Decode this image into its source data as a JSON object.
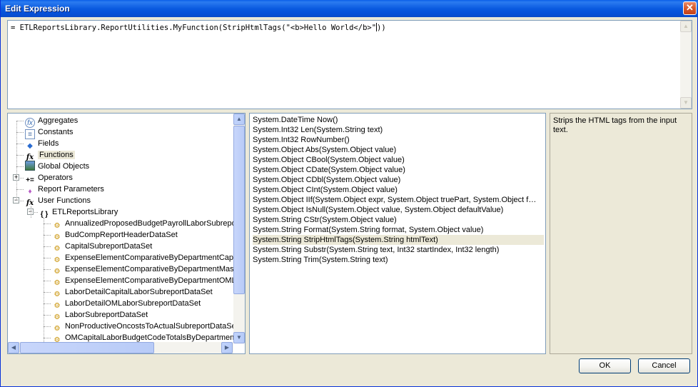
{
  "window": {
    "title": "Edit Expression",
    "close_glyph": "✕"
  },
  "expression": {
    "text_before_caret": "= ETLReportsLibrary.ReportUtilities.MyFunction(StripHtmlTags(\"<b>Hello World</b>\"",
    "text_after_caret": "))"
  },
  "tree": {
    "items": [
      {
        "label": "Aggregates",
        "icon": "aggregates-icon",
        "glyph": "fx"
      },
      {
        "label": "Constants",
        "icon": "constants-icon",
        "glyph": "≡"
      },
      {
        "label": "Fields",
        "icon": "fields-icon",
        "glyph": "◆"
      },
      {
        "label": "Functions",
        "icon": "functions-icon",
        "glyph": "fx"
      },
      {
        "label": "Global Objects",
        "icon": "global-objects-icon",
        "glyph": ""
      },
      {
        "label": "Operators",
        "icon": "operators-icon",
        "glyph": "+="
      },
      {
        "label": "Report Parameters",
        "icon": "report-parameters-icon",
        "glyph": "♦"
      },
      {
        "label": "User Functions",
        "icon": "user-functions-icon",
        "glyph": "fx"
      },
      {
        "label": "ETLReportsLibrary",
        "icon": "namespace-braces-icon",
        "glyph": "{ }"
      },
      {
        "label": "AnnualizedProposedBudgetPayrollLaborSubreport",
        "icon": "dataset-icon",
        "glyph": "⚙"
      },
      {
        "label": "BudCompReportHeaderDataSet",
        "icon": "dataset-icon",
        "glyph": "⚙"
      },
      {
        "label": "CapitalSubreportDataSet",
        "icon": "dataset-icon",
        "glyph": "⚙"
      },
      {
        "label": "ExpenseElementComparativeByDepartmentCapit",
        "icon": "dataset-icon",
        "glyph": "⚙"
      },
      {
        "label": "ExpenseElementComparativeByDepartmentMast",
        "icon": "dataset-icon",
        "glyph": "⚙"
      },
      {
        "label": "ExpenseElementComparativeByDepartmentOMLa",
        "icon": "dataset-icon",
        "glyph": "⚙"
      },
      {
        "label": "LaborDetailCapitalLaborSubreportDataSet",
        "icon": "dataset-icon",
        "glyph": "⚙"
      },
      {
        "label": "LaborDetailOMLaborSubreportDataSet",
        "icon": "dataset-icon",
        "glyph": "⚙"
      },
      {
        "label": "LaborSubreportDataSet",
        "icon": "dataset-icon",
        "glyph": "⚙"
      },
      {
        "label": "NonProductiveOncostsToActualSubreportDataSe",
        "icon": "dataset-icon",
        "glyph": "⚙"
      },
      {
        "label": "OMCapitalLaborBudgetCodeTotalsByDepartment",
        "icon": "dataset-icon",
        "glyph": "⚙"
      }
    ],
    "selected_label": "Functions",
    "expander_plus": "+",
    "expander_minus": "−"
  },
  "functions": {
    "items": [
      "System.DateTime Now()",
      "System.Int32 Len(System.String text)",
      "System.Int32 RowNumber()",
      "System.Object Abs(System.Object value)",
      "System.Object CBool(System.Object value)",
      "System.Object CDate(System.Object value)",
      "System.Object CDbl(System.Object value)",
      "System.Object CInt(System.Object value)",
      "System.Object IIf(System.Object expr, System.Object truePart, System.Object f…",
      "System.Object IsNull(System.Object value, System.Object defaultValue)",
      "System.String CStr(System.Object value)",
      "System.String Format(System.String format, System.Object value)",
      "System.String StripHtmlTags(System.String htmlText)",
      "System.String Substr(System.String text, Int32 startIndex, Int32 length)",
      "System.String Trim(System.String text)"
    ],
    "selected": "System.String StripHtmlTags(System.String htmlText)"
  },
  "description": {
    "text": "Strips the HTML tags from the input text."
  },
  "buttons": {
    "ok": "OK",
    "cancel": "Cancel"
  },
  "scroll_glyphs": {
    "up": "▲",
    "down": "▼",
    "left": "◀",
    "right": "▶"
  }
}
